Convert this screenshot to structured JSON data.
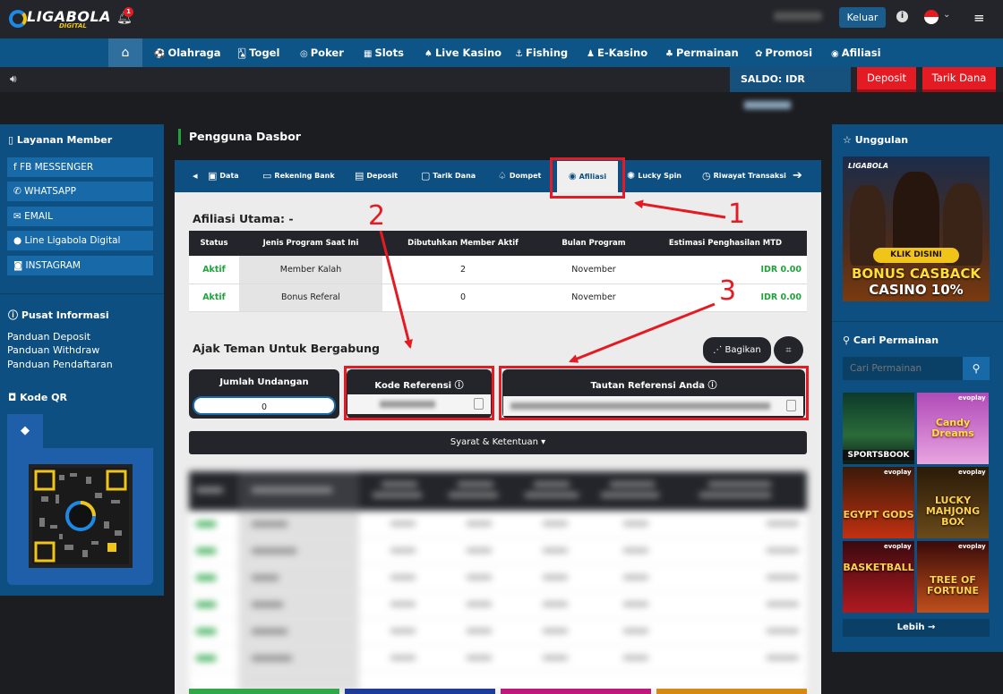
{
  "header": {
    "logo_text": "LIGABOLA",
    "logo_sub": "DIGITAL",
    "notification_count": "1",
    "logout_label": "Keluar"
  },
  "nav": {
    "items": [
      {
        "icon": "⚽",
        "label": "Olahraga"
      },
      {
        "icon": "🂡",
        "label": "Togel"
      },
      {
        "icon": "◎",
        "label": "Poker"
      },
      {
        "icon": "▦",
        "label": "Slots"
      },
      {
        "icon": "♠",
        "label": "Live Kasino"
      },
      {
        "icon": "⚓",
        "label": "Fishing"
      },
      {
        "icon": "♟",
        "label": "E-Kasino"
      },
      {
        "icon": "♣",
        "label": "Permainan"
      },
      {
        "icon": "✿",
        "label": "Promosi"
      },
      {
        "icon": "◉",
        "label": "Afiliasi"
      }
    ]
  },
  "balance": {
    "label": "SALDO: IDR",
    "deposit_label": "Deposit",
    "withdraw_label": "Tarik Dana"
  },
  "left_sidebar": {
    "member_title": "Layanan Member",
    "contacts": [
      "FB MESSENGER",
      "WHATSAPP",
      "EMAIL",
      "Line Ligabola Digital",
      "INSTAGRAM"
    ],
    "info_title": "Pusat Informasi",
    "info_links": [
      "Panduan Deposit",
      "Panduan Withdraw",
      "Panduan Pendaftaran"
    ],
    "qr_title": "Kode QR"
  },
  "dashboard": {
    "title": "Pengguna Dasbor",
    "tabs": [
      "Data",
      "Rekening Bank",
      "Deposit",
      "Tarik Dana",
      "Dompet",
      "Afiliasi",
      "Lucky Spin",
      "Riwayat Transaksi"
    ],
    "active_tab": "Afiliasi",
    "affiliate_title": "Afiliasi Utama: -",
    "table_headers": [
      "Status",
      "Jenis Program Saat Ini",
      "Dibutuhkan Member Aktif",
      "Bulan Program",
      "Estimasi Penghasilan MTD"
    ],
    "table_rows": [
      [
        "Aktif",
        "Member Kalah",
        "2",
        "November",
        "IDR 0.00"
      ],
      [
        "Aktif",
        "Bonus Referal",
        "0",
        "November",
        "IDR 0.00"
      ]
    ],
    "invite_title": "Ajak Teman Untuk Bergabung",
    "share_label": "Bagikan",
    "invites_label": "Jumlah Undangan",
    "invites_value": "0",
    "referral_code_label": "Kode Referensi",
    "referral_link_label": "Tautan Referensi Anda",
    "terms_label": "Syarat & Ketentuan"
  },
  "annotations": [
    "1",
    "2",
    "3"
  ],
  "right_sidebar": {
    "featured_title": "Unggulan",
    "banner_cta": "KLIK DISINI",
    "banner_line1": "BONUS CASBACK",
    "banner_line2": "CASINO 10%",
    "search_title": "Cari Permainan",
    "search_placeholder": "Cari Permainan",
    "games": [
      {
        "name": "SPORTSBOOK",
        "tag": ""
      },
      {
        "name": "Candy Dreams",
        "tag": "evoplay"
      },
      {
        "name": "EGYPT GODS",
        "tag": "evoplay"
      },
      {
        "name": "LUCKY MAHJONG BOX",
        "tag": "evoplay"
      },
      {
        "name": "BASKETBALL",
        "tag": "evoplay"
      },
      {
        "name": "TREE OF FORTUNE",
        "tag": "evoplay"
      }
    ],
    "more_label": "Lebih →"
  },
  "colors": {
    "accent_blue": "#0d4f80",
    "nav_blue": "#0d5487",
    "danger_red": "#e41b23",
    "success_green": "#1fa33a",
    "dark": "#23252b"
  }
}
